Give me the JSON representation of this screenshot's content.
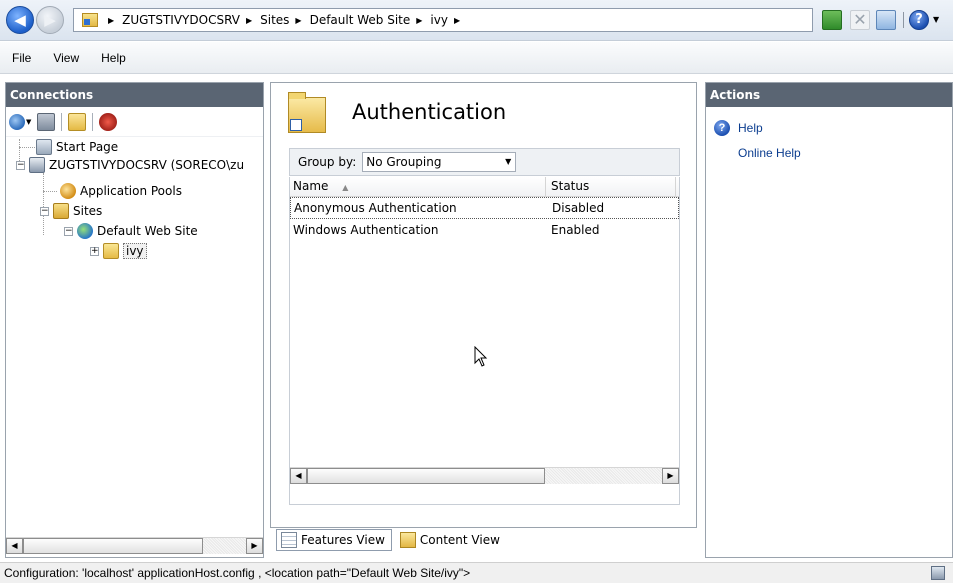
{
  "address": {
    "crumbs": [
      "ZUGTSTIVYDOCSRV",
      "Sites",
      "Default Web Site",
      "ivy"
    ],
    "separator": "▶"
  },
  "menu": {
    "items": [
      "File",
      "View",
      "Help"
    ]
  },
  "connections": {
    "title": "Connections",
    "tree": {
      "start_page": "Start Page",
      "server": "ZUGTSTIVYDOCSRV (SORECO\\zu",
      "app_pools": "Application Pools",
      "sites": "Sites",
      "default_site": "Default Web Site",
      "ivy": "ivy"
    }
  },
  "center": {
    "title": "Authentication",
    "group_by_label": "Group by:",
    "group_by_value": "No Grouping",
    "columns": {
      "name": "Name",
      "status": "Status"
    },
    "rows": [
      {
        "name": "Anonymous Authentication",
        "status": "Disabled"
      },
      {
        "name": "Windows Authentication",
        "status": "Enabled"
      }
    ],
    "tabs": {
      "features": "Features View",
      "content": "Content View"
    }
  },
  "actions": {
    "title": "Actions",
    "help": "Help",
    "online_help": "Online Help"
  },
  "status": {
    "text": "Configuration: 'localhost' applicationHost.config , <location path=\"Default Web Site/ivy\">"
  },
  "colors": {
    "panel_header": "#5a6573",
    "link": "#0b3d8f"
  }
}
